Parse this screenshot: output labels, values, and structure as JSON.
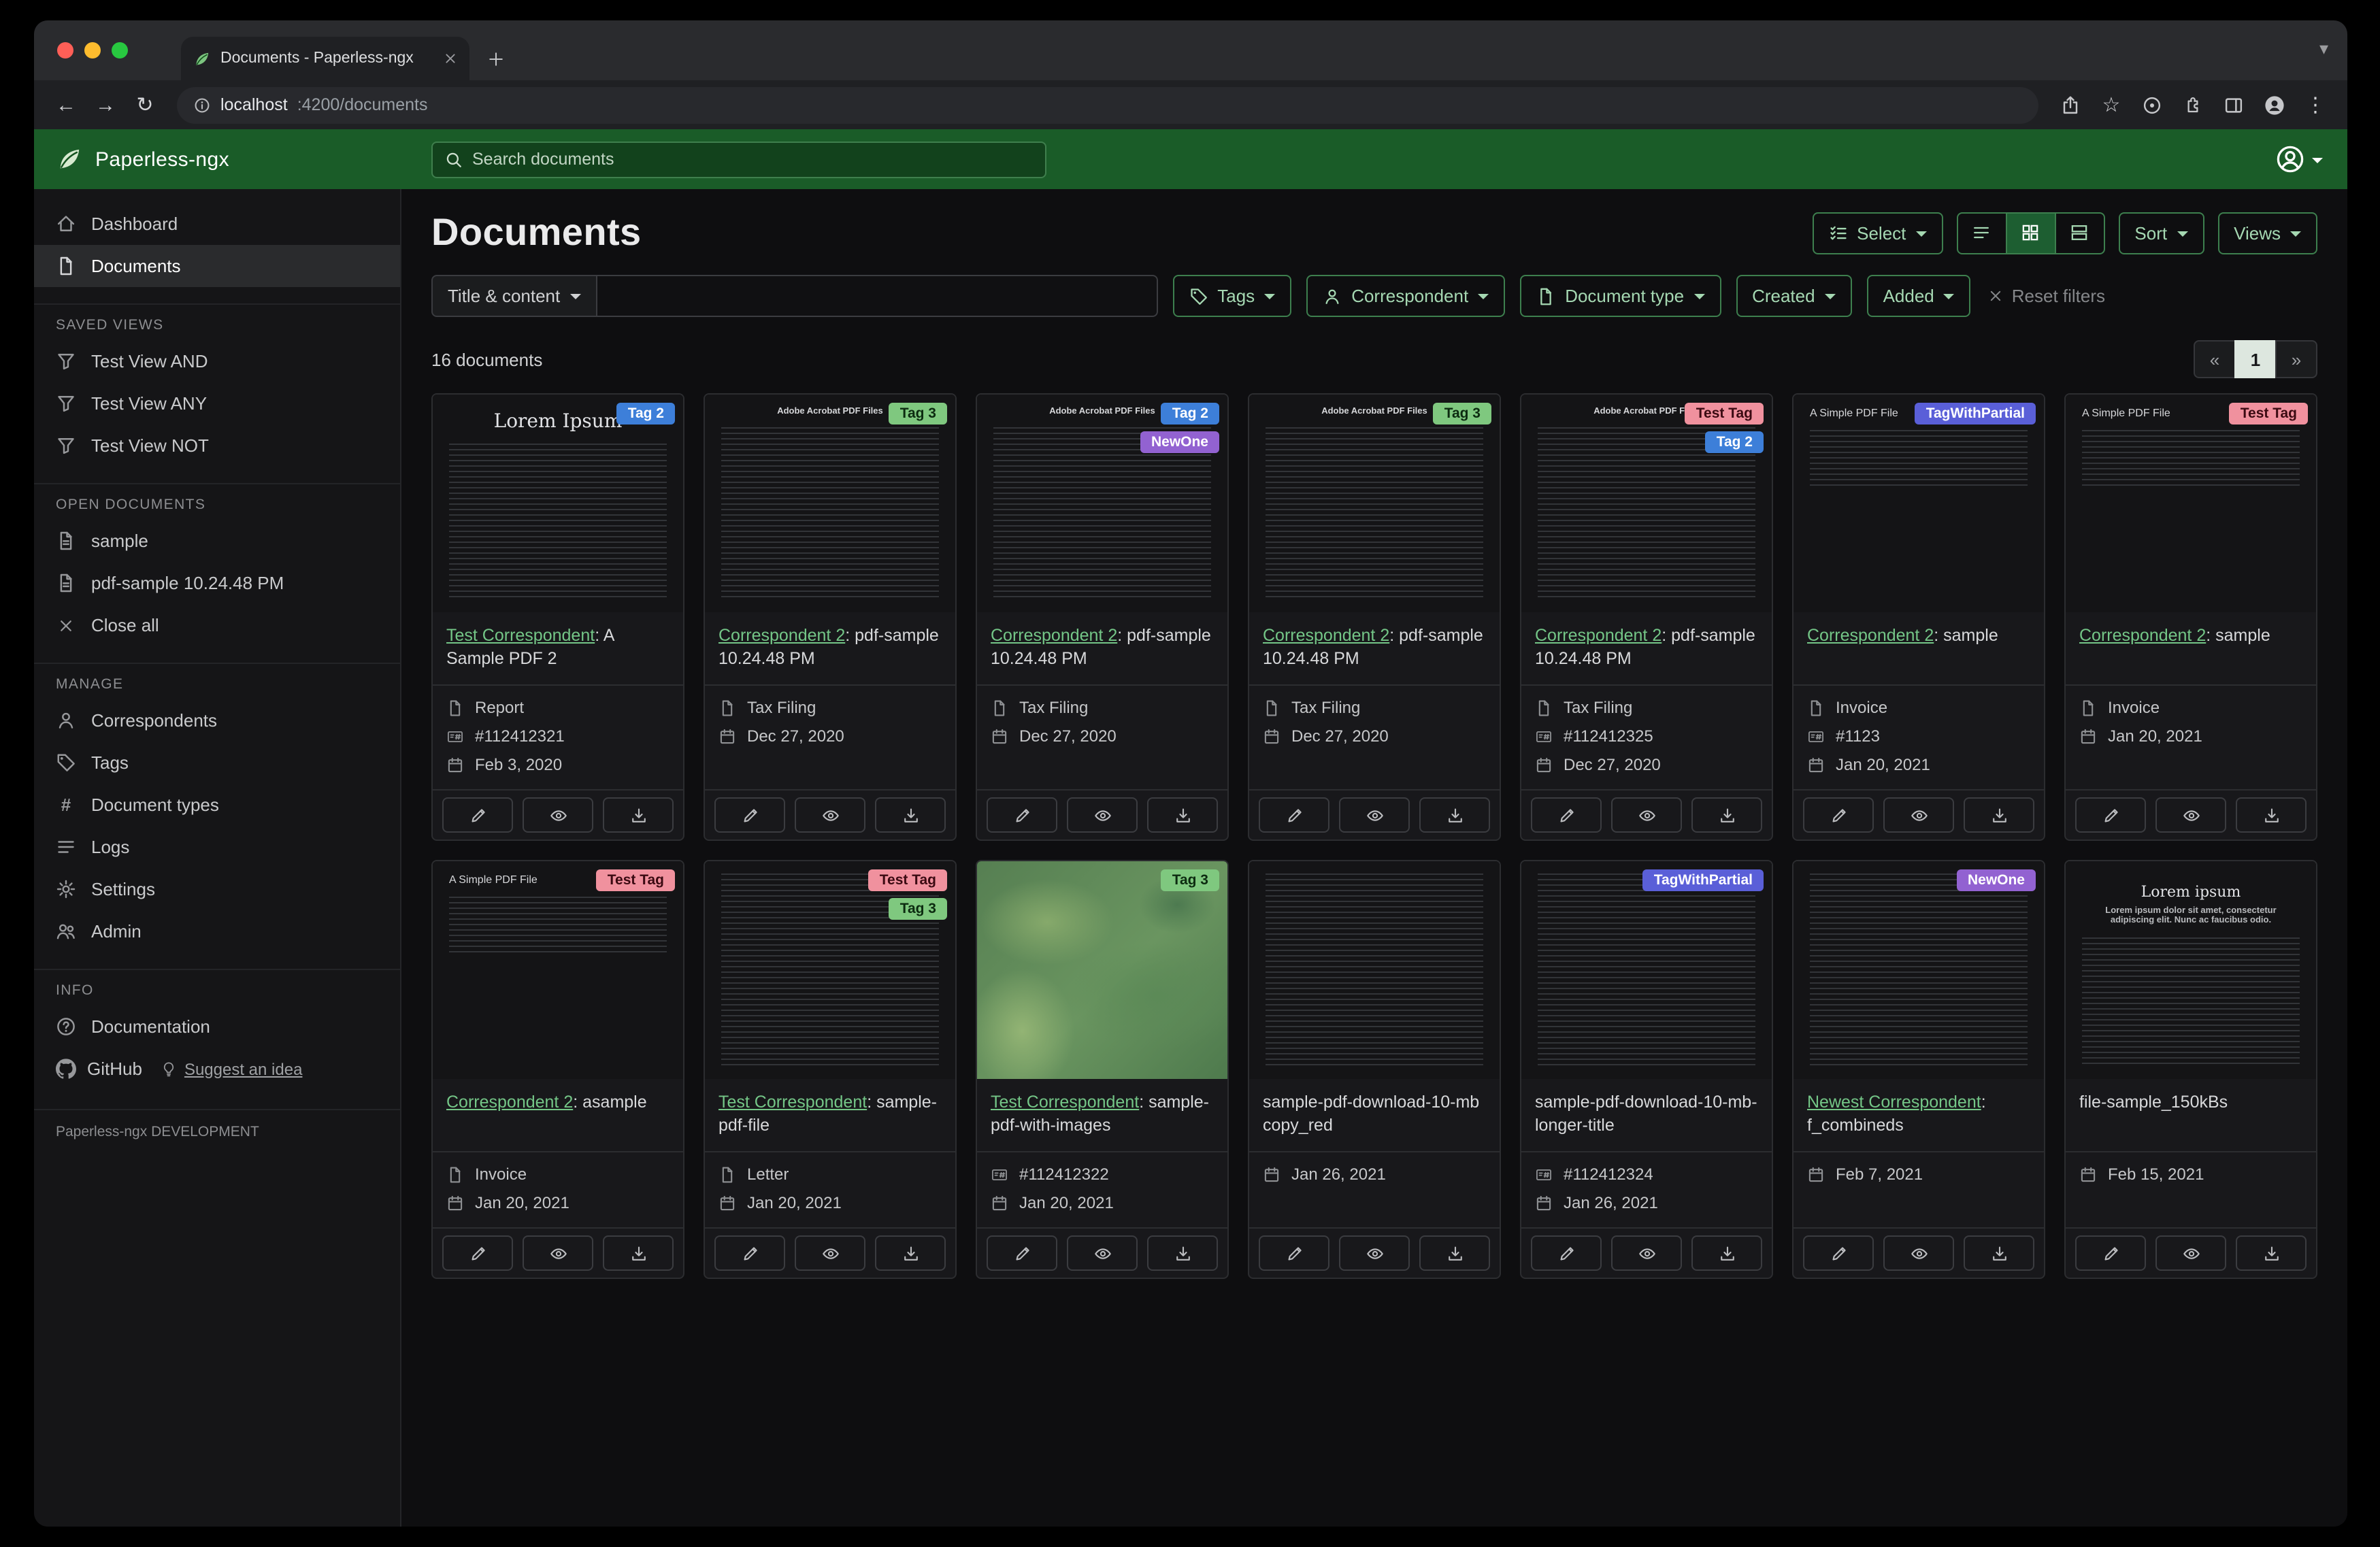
{
  "browser": {
    "tab_title": "Documents - Paperless-ngx",
    "url_host": "localhost",
    "url_path": ":4200/documents"
  },
  "app_header": {
    "brand": "Paperless-ngx",
    "search_placeholder": "Search documents"
  },
  "colors": {
    "header_green": "#1a5c28",
    "accent_border": "#3d7f4e",
    "accent_text": "#a5d8b2",
    "link_green": "#74c687",
    "active_toggle_fill": "#1d5e31"
  },
  "sidebar": {
    "dashboard": "Dashboard",
    "documents": "Documents",
    "saved_views_label": "SAVED VIEWS",
    "view_and": "Test View AND",
    "view_any": "Test View ANY",
    "view_not": "Test View NOT",
    "open_documents_label": "OPEN DOCUMENTS",
    "open_sample": "sample",
    "open_pdf_sample": "pdf-sample 10.24.48 PM",
    "close_all": "Close all",
    "manage_label": "MANAGE",
    "correspondents": "Correspondents",
    "tags": "Tags",
    "document_types": "Document types",
    "logs": "Logs",
    "settings": "Settings",
    "admin": "Admin",
    "info_label": "INFO",
    "documentation": "Documentation",
    "github": "GitHub",
    "suggest_idea": "Suggest an idea",
    "footer": "Paperless-ngx DEVELOPMENT"
  },
  "main": {
    "title": "Documents",
    "toolbar": {
      "select": "Select",
      "sort": "Sort",
      "views": "Views"
    },
    "filters": {
      "title_content": "Title & content",
      "tags": "Tags",
      "correspondent": "Correspondent",
      "document_type": "Document type",
      "created": "Created",
      "added": "Added",
      "reset": "Reset filters"
    },
    "count": "16 documents",
    "pagination": {
      "prev": "«",
      "page": "1",
      "next": "»"
    },
    "documents": [
      {
        "tags": [
          {
            "label": "Tag 2",
            "bg": "#3d7fd9",
            "fg": "#ffffff"
          }
        ],
        "link": "Test Correspondent",
        "suffix": ": A Sample PDF 2",
        "type": "Report",
        "asn": "#112412321",
        "date": "Feb 3, 2020",
        "thumb": "lorem",
        "thumb_title": "Lorem Ipsum"
      },
      {
        "tags": [
          {
            "label": "Tag 3",
            "bg": "#7fc87f",
            "fg": "#0c2b10"
          }
        ],
        "link": "Correspondent 2",
        "suffix": ": pdf-sample 10.24.48 PM",
        "type": "Tax Filing",
        "date": "Dec 27, 2020",
        "thumb": "pdfdoc",
        "thumb_title": "Adobe Acrobat PDF Files"
      },
      {
        "tags": [
          {
            "label": "Tag 2",
            "bg": "#3d7fd9",
            "fg": "#ffffff"
          },
          {
            "label": "NewOne",
            "bg": "#9262d1",
            "fg": "#ffffff"
          }
        ],
        "link": "Correspondent 2",
        "suffix": ": pdf-sample 10.24.48 PM",
        "type": "Tax Filing",
        "date": "Dec 27, 2020",
        "thumb": "pdfdoc",
        "thumb_title": "Adobe Acrobat PDF Files"
      },
      {
        "tags": [
          {
            "label": "Tag 3",
            "bg": "#7fc87f",
            "fg": "#0c2b10"
          }
        ],
        "link": "Correspondent 2",
        "suffix": ": pdf-sample 10.24.48 PM",
        "type": "Tax Filing",
        "date": "Dec 27, 2020",
        "thumb": "pdfdoc",
        "thumb_title": "Adobe Acrobat PDF Files"
      },
      {
        "tags": [
          {
            "label": "Test Tag",
            "bg": "#f0919e",
            "fg": "#3b0a12"
          },
          {
            "label": "Tag 2",
            "bg": "#3d7fd9",
            "fg": "#ffffff"
          }
        ],
        "link": "Correspondent 2",
        "suffix": ": pdf-sample 10.24.48 PM",
        "type": "Tax Filing",
        "asn": "#112412325",
        "date": "Dec 27, 2020",
        "thumb": "pdfdoc",
        "thumb_title": "Adobe Acrobat PDF Files"
      },
      {
        "tags": [
          {
            "label": "TagWithPartial",
            "bg": "#5a5fd8",
            "fg": "#ffffff"
          }
        ],
        "link": "Correspondent 2",
        "suffix": ": sample",
        "type": "Invoice",
        "asn": "#1123",
        "date": "Jan 20, 2021",
        "thumb": "simple",
        "thumb_title": "A Simple PDF File"
      },
      {
        "tags": [
          {
            "label": "Test Tag",
            "bg": "#f0919e",
            "fg": "#3b0a12"
          }
        ],
        "link": "Correspondent 2",
        "suffix": ": sample",
        "type": "Invoice",
        "date": "Jan 20, 2021",
        "thumb": "simple",
        "thumb_title": "A Simple PDF File"
      },
      {
        "tags": [
          {
            "label": "Test Tag",
            "bg": "#f0919e",
            "fg": "#3b0a12"
          }
        ],
        "link": "Correspondent 2",
        "suffix": ": asample",
        "type": "Invoice",
        "date": "Jan 20, 2021",
        "thumb": "simple",
        "thumb_title": "A Simple PDF File"
      },
      {
        "tags": [
          {
            "label": "Test Tag",
            "bg": "#f0919e",
            "fg": "#3b0a12"
          },
          {
            "label": "Tag 3",
            "bg": "#7fc87f",
            "fg": "#0c2b10"
          }
        ],
        "link": "Test Correspondent",
        "suffix": ": sample-pdf-file",
        "type": "Letter",
        "date": "Jan 20, 2021",
        "thumb": "dense"
      },
      {
        "tags": [
          {
            "label": "Tag 3",
            "bg": "#7fc87f",
            "fg": "#0c2b10"
          }
        ],
        "link": "Test Correspondent",
        "suffix": ": sample-pdf-with-images",
        "asn": "#112412322",
        "date": "Jan 20, 2021",
        "thumb": "map"
      },
      {
        "tags": [],
        "suffix": "sample-pdf-download-10-mb copy_red",
        "date": "Jan 26, 2021",
        "thumb": "dense"
      },
      {
        "tags": [
          {
            "label": "TagWithPartial",
            "bg": "#5a5fd8",
            "fg": "#ffffff"
          }
        ],
        "suffix": "sample-pdf-download-10-mb-longer-title",
        "asn": "#112412324",
        "date": "Jan 26, 2021",
        "thumb": "dense"
      },
      {
        "tags": [
          {
            "label": "NewOne",
            "bg": "#9262d1",
            "fg": "#ffffff"
          }
        ],
        "link": "Newest Correspondent",
        "suffix": ": f_combineds",
        "date": "Feb 7, 2021",
        "thumb": "dense"
      },
      {
        "tags": [],
        "suffix": "file-sample_150kBs",
        "date": "Feb 15, 2021",
        "thumb": "loremcenter",
        "thumb_title": "Lorem ipsum",
        "thumb_sub": "Lorem ipsum dolor sit amet, consectetur adipiscing elit. Nunc ac faucibus odio."
      }
    ]
  }
}
